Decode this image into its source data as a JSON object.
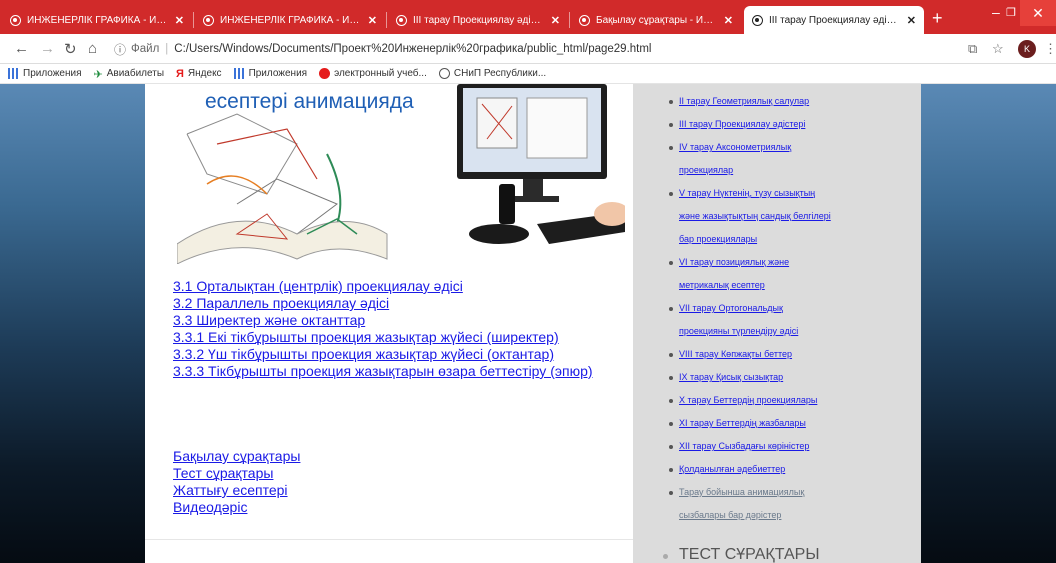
{
  "browser": {
    "tabs": [
      {
        "label": "ИНЖЕНЕРЛІК ГРАФИКА - ИНЖ"
      },
      {
        "label": "ИНЖЕНЕРЛІК ГРАФИКА - ИНЖ"
      },
      {
        "label": "III тарау Проекциялау әдістері"
      },
      {
        "label": "Бақылау сұрақтары - ИНЖЕНЕ"
      },
      {
        "label": "III тарау Проекциялау әдістері"
      }
    ],
    "address": {
      "scheme": "Файл",
      "url": "C:/Users/Windows/Documents/Проект%20Инженерлік%20графика/public_html/page29.html"
    },
    "profile_initial": "K",
    "bookmarks": [
      {
        "label": "Приложения",
        "icon": "apps-grid-icon"
      },
      {
        "label": "Авиабилеты",
        "icon": "plane-icon"
      },
      {
        "label": "Яндекс",
        "icon": "yandex-icon"
      },
      {
        "label": "Приложения",
        "icon": "apps-grid-icon"
      },
      {
        "label": "электронный учеб...",
        "icon": "red-dot-icon"
      },
      {
        "label": "СНиП Республики...",
        "icon": "globe-icon"
      }
    ]
  },
  "hero": {
    "title": "есептері анимацияда"
  },
  "toc": [
    {
      "label": "3.1 Орталықтан (центрлік) проекциялау әдісі"
    },
    {
      "label": "3.2 Параллель проекциялау әдісі"
    },
    {
      "label": "3.3 Ширектер және октанттар"
    },
    {
      "label": "3.3.1 Екі тікбұрышты проекция жазықтар жүйесі (ширектер)"
    },
    {
      "label": "3.3.2 Үш тікбұрышты проекция жазықтар жүйесі (октантар)"
    },
    {
      "label": "3.3.3 Тікбұрышты проекция жазықтарын өзара беттестіру (эпюр)"
    }
  ],
  "links": [
    {
      "label": "Бақылау сұрақтары"
    },
    {
      "label": "Тест сұрақтары"
    },
    {
      "label": "Жаттығу есептері"
    },
    {
      "label": "Видеодәріс"
    }
  ],
  "sidebar": {
    "items": [
      {
        "label": "II тарау Геометриялық салулар"
      },
      {
        "label": "III тарау Проекциялау әдістері"
      },
      {
        "label": "IV тарау Аксонометриялық",
        "cont": "проекциялар"
      },
      {
        "label": "V тарау Нүктенің, түзу сызықтың",
        "cont": "және жазықтықтың сандық белгілері",
        "cont2": "бар проекциялары"
      },
      {
        "label": "VI тарау позициялық және",
        "cont": "метрикалық есептер"
      },
      {
        "label": "VII тарау Ортогональдық",
        "cont": "проекцияны түрлендіру әдісі"
      },
      {
        "label": "VIII тарау Көпжақты беттер"
      },
      {
        "label": "IX тарау Қисық сызықтар"
      },
      {
        "label": "X тарау Беттердің проекциялары"
      },
      {
        "label": "XI тарау Беттердің жазбалары"
      },
      {
        "label": "XII тарау Сызбадағы көріністер"
      },
      {
        "label": "Қолданылған әдебиеттер"
      },
      {
        "label": "Тарау бойынша анимациялық",
        "cont": "сызбалары бар дәрістер",
        "gray": true
      }
    ],
    "heading": "ТЕСТ СҰРАҚТАРЫ"
  },
  "colors": {
    "tabbar": "#d12a2a",
    "link": "#1a1ae6",
    "hero_title": "#1f5fb5",
    "sidebar_bg": "#dcdcdc"
  }
}
